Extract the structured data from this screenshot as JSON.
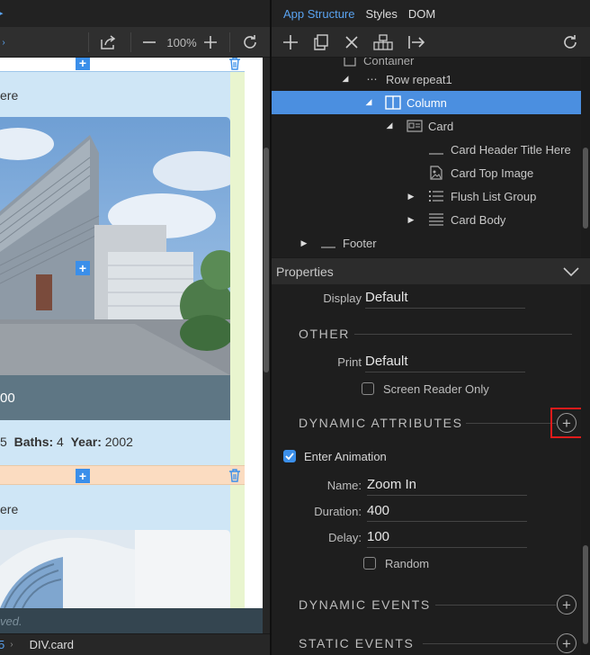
{
  "app": {
    "tabs": [
      "App Structure",
      "Styles",
      "DOM"
    ]
  },
  "toolbar_left": {
    "zoom": "100%"
  },
  "canvas": {
    "card1_header_fragment": "ere",
    "card1_price_fragment": "00",
    "card1_features": {
      "beds_fragment": "5",
      "baths_label": "Baths:",
      "baths_value": "4",
      "year_label": "Year:",
      "year_value": "2002"
    },
    "card2_header_fragment": "ere",
    "notice_fragment": "ved."
  },
  "statusbar": {
    "breadcrumb_fragment": "5",
    "element": "DIV.card"
  },
  "tree": {
    "rows": [
      {
        "label": "Container",
        "level": 2
      },
      {
        "label": "Row repeat1",
        "level": 3
      },
      {
        "label": "Column",
        "level": 4,
        "selected": true
      },
      {
        "label": "Card",
        "level": 5
      },
      {
        "label": "Card Header Title Here",
        "level": 6
      },
      {
        "label": "Card Top Image",
        "level": 6
      },
      {
        "label": "Flush List Group",
        "level": 6
      },
      {
        "label": "Card Body",
        "level": 6
      },
      {
        "label": "Footer",
        "level": 1
      }
    ]
  },
  "properties": {
    "header": "Properties",
    "display_label": "Display",
    "display_value": "Default",
    "other_title": "OTHER",
    "print_label": "Print",
    "print_value": "Default",
    "screen_reader_label": "Screen Reader Only",
    "dynamic_attributes_title": "DYNAMIC ATTRIBUTES",
    "enter_animation_label": "Enter Animation",
    "name_label": "Name:",
    "name_value": "Zoom In",
    "duration_label": "Duration:",
    "duration_value": "400",
    "delay_label": "Delay:",
    "delay_value": "100",
    "random_label": "Random",
    "dynamic_events_title": "DYNAMIC EVENTS",
    "static_events_title": "STATIC EVENTS"
  },
  "colors": {
    "accent": "#4b8fe0",
    "highlight_box": "#e01b1b",
    "checkbox_checked": "#3b8fea"
  }
}
